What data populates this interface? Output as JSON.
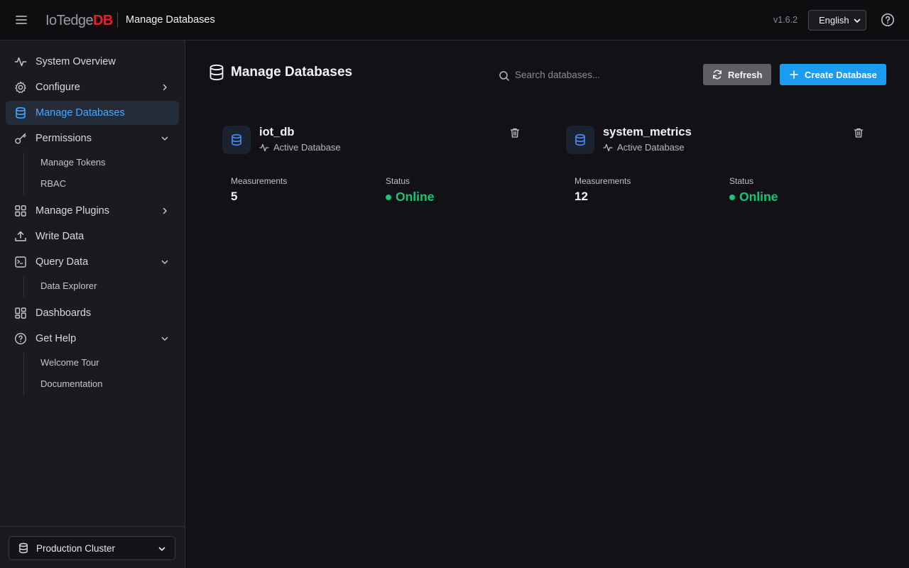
{
  "header": {
    "brand_prefix": "IoTedge",
    "brand_suffix": "DB",
    "page_title": "Manage Databases",
    "version": "v1.6.2",
    "language": "English",
    "icons": {
      "menu": "hamburger-icon",
      "help": "help-circle-icon"
    }
  },
  "sidebar": {
    "items": [
      {
        "label": "System Overview",
        "icon": "activity-icon"
      },
      {
        "label": "Configure",
        "icon": "gear-icon"
      },
      {
        "label": "Manage Databases",
        "icon": "database-icon",
        "active": true
      },
      {
        "label": "Permissions",
        "icon": "key-icon"
      },
      {
        "label": "Manage Plugins",
        "icon": "grid-icon"
      },
      {
        "label": "Write Data",
        "icon": "upload-icon"
      },
      {
        "label": "Query Data",
        "icon": "terminal-icon"
      },
      {
        "label": "Dashboards",
        "icon": "dashboard-icon"
      },
      {
        "label": "Get Help",
        "icon": "help-circle-icon"
      }
    ],
    "permissions_sub": [
      "Manage Tokens",
      "RBAC"
    ],
    "query_sub": [
      "Data Explorer"
    ],
    "help_sub": [
      "Welcome Tour",
      "Documentation"
    ],
    "cluster": "Production Cluster"
  },
  "main": {
    "title": "Manage Databases",
    "search_placeholder": "Search databases...",
    "search_value": "",
    "refresh_label": "Refresh",
    "create_label": "Create Database",
    "databases": [
      {
        "name": "iot_db",
        "subtitle": "Active Database",
        "measurements_label": "Measurements",
        "measurements": "5",
        "status_label": "Status",
        "status": "Online"
      },
      {
        "name": "system_metrics",
        "subtitle": "Active Database",
        "measurements_label": "Measurements",
        "measurements": "12",
        "status_label": "Status",
        "status": "Online"
      }
    ]
  },
  "colors": {
    "accent": "#1a9cf0",
    "active_nav_text": "#4aa8ff",
    "status_online": "#16c47a",
    "brand_db": "#e0242f"
  }
}
